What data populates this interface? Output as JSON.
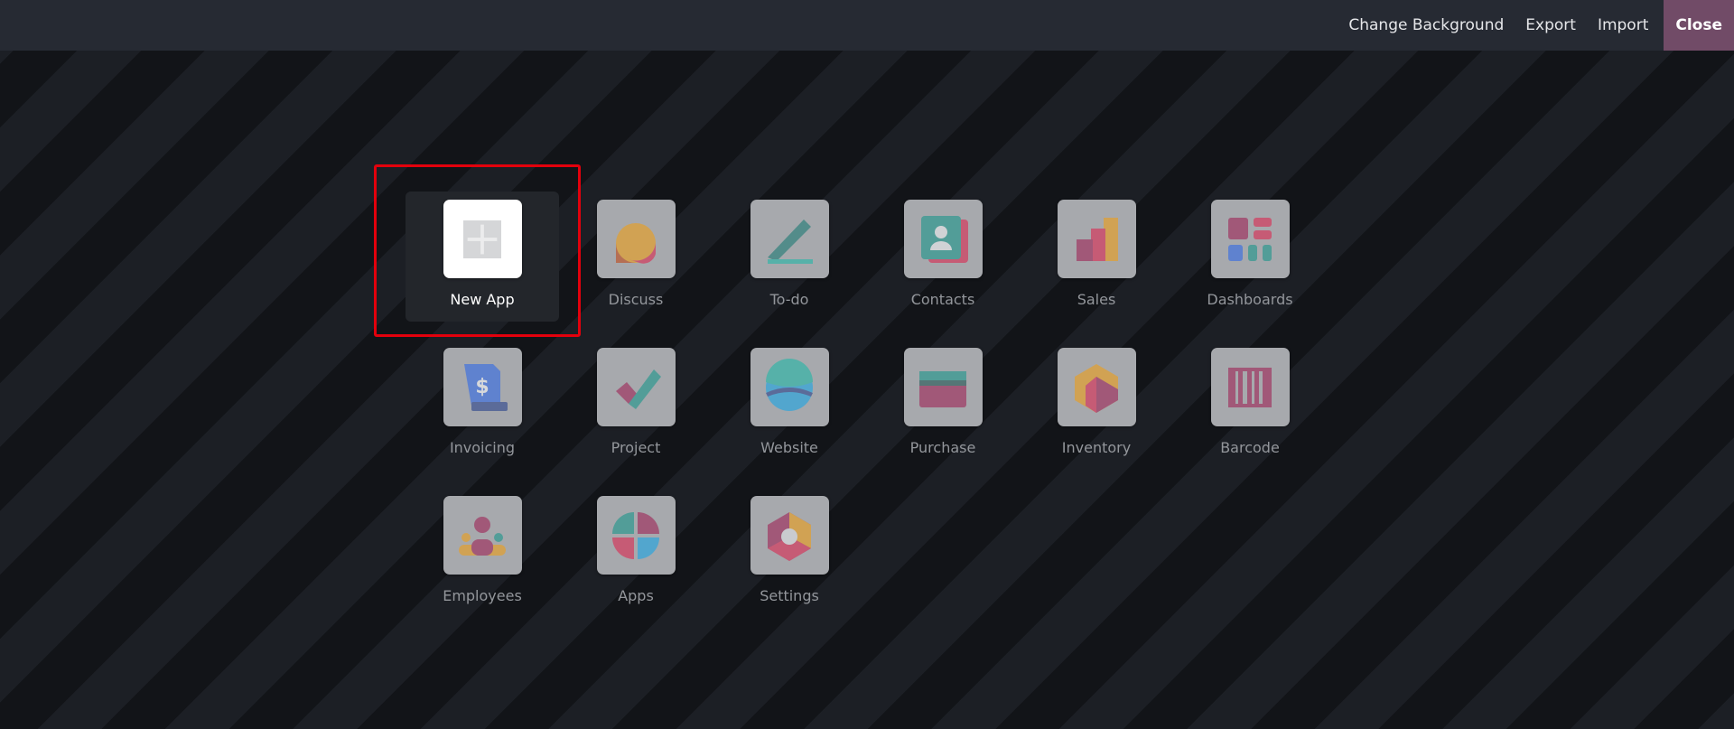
{
  "topbar": {
    "change_background": "Change Background",
    "export": "Export",
    "import": "Import",
    "close": "Close",
    "close_color": "#714b67"
  },
  "apps": [
    {
      "label": "New App",
      "icon": "plus-icon"
    },
    {
      "label": "Discuss",
      "icon": "discuss-icon"
    },
    {
      "label": "To-do",
      "icon": "todo-icon"
    },
    {
      "label": "Contacts",
      "icon": "contacts-icon"
    },
    {
      "label": "Sales",
      "icon": "sales-icon"
    },
    {
      "label": "Dashboards",
      "icon": "dashboards-icon"
    },
    {
      "label": "Invoicing",
      "icon": "invoicing-icon"
    },
    {
      "label": "Project",
      "icon": "project-icon"
    },
    {
      "label": "Website",
      "icon": "website-icon"
    },
    {
      "label": "Purchase",
      "icon": "purchase-icon"
    },
    {
      "label": "Inventory",
      "icon": "inventory-icon"
    },
    {
      "label": "Barcode",
      "icon": "barcode-icon"
    },
    {
      "label": "Employees",
      "icon": "employees-icon"
    },
    {
      "label": "Apps",
      "icon": "apps-icon"
    },
    {
      "label": "Settings",
      "icon": "settings-icon"
    }
  ],
  "highlight_color": "#e3000c"
}
